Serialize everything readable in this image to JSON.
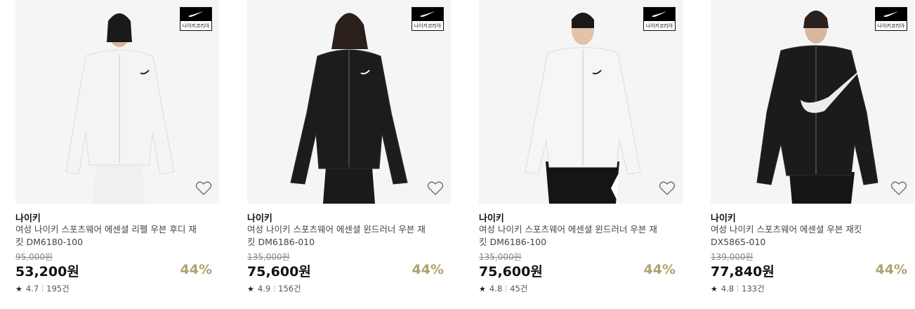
{
  "brand_badge_text": "나이키코리아",
  "products": [
    {
      "brand": "나이키",
      "title": "여성 나이키 스포츠웨어 에센셜 리펠 우븐 후디 재킷 DM6180-100",
      "original_price": "95,000원",
      "price": "53,200원",
      "discount": "44%",
      "rating": "4.7",
      "reviews": "195건",
      "jacket_color": "#f4f4f4",
      "pants_color": "#f0f0f0"
    },
    {
      "brand": "나이키",
      "title": "여성 나이키 스포츠웨어 에센셜 윈드러너 우븐 재킷 DM6186-010",
      "original_price": "135,000원",
      "price": "75,600원",
      "discount": "44%",
      "rating": "4.9",
      "reviews": "156건",
      "jacket_color": "#1c1c1e",
      "pants_color": "#1a1a1a"
    },
    {
      "brand": "나이키",
      "title": "여성 나이키 스포츠웨어 에센셜 윈드러너 우븐 재킷 DM6186-100",
      "original_price": "135,000원",
      "price": "75,600원",
      "discount": "44%",
      "rating": "4.8",
      "reviews": "45건",
      "jacket_color": "#f6f6f4",
      "pants_color": "#151515"
    },
    {
      "brand": "나이키",
      "title": "여성 나이키 스포츠웨어 에센셜 우븐 재킷 DX5865-010",
      "original_price": "139,000원",
      "price": "77,840원",
      "discount": "44%",
      "rating": "4.8",
      "reviews": "133건",
      "jacket_color": "#1b1b1b",
      "pants_color": "#151515"
    }
  ],
  "icons": {
    "heart": "heart-outline-icon",
    "star": "star-icon",
    "logo": "nike-swoosh-icon"
  },
  "colors": {
    "discount": "#b29f6e",
    "image_bg": "#f5f5f5"
  }
}
